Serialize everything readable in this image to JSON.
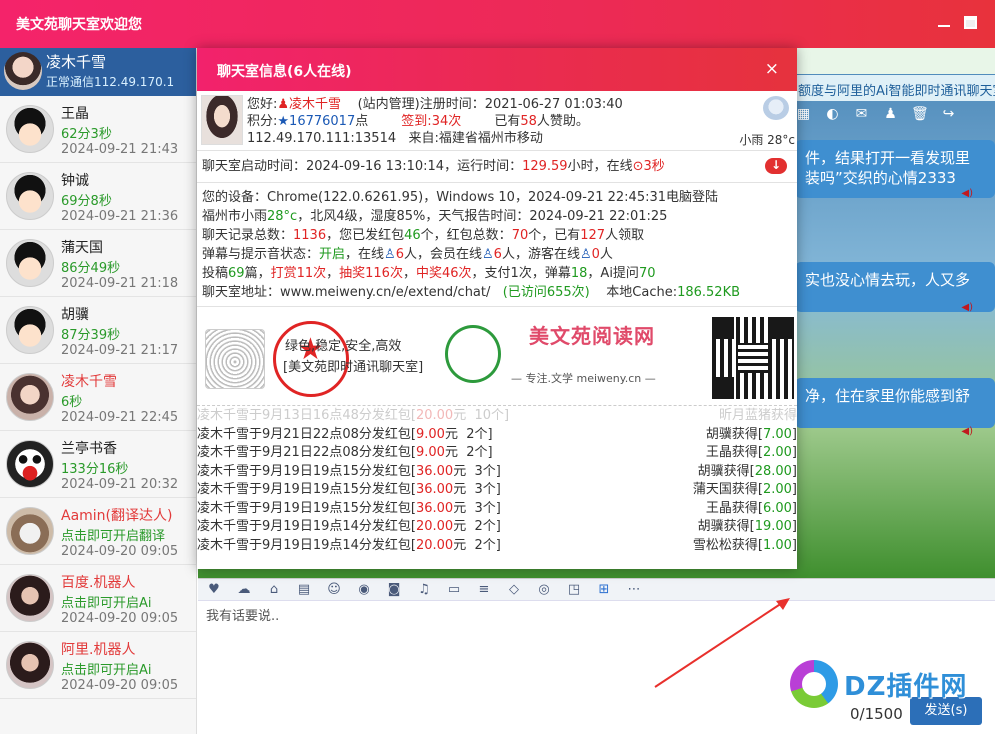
{
  "window": {
    "title": "美文苑聊天室欢迎您"
  },
  "me": {
    "name": "凌木千雪",
    "status": "正常通信112.49.170.1"
  },
  "users": [
    {
      "name": "王晶",
      "online": "62分3秒",
      "time": "2024-09-21 21:43",
      "name_color": "normal"
    },
    {
      "name": "钟诚",
      "online": "69分8秒",
      "time": "2024-09-21 21:36",
      "name_color": "normal"
    },
    {
      "name": "蒲天国",
      "online": "86分49秒",
      "time": "2024-09-21 21:18",
      "name_color": "normal"
    },
    {
      "name": "胡骥",
      "online": "87分39秒",
      "time": "2024-09-21 21:17",
      "name_color": "normal"
    },
    {
      "name": "凌木千雪",
      "online": "6秒",
      "time": "2024-09-21 22:45",
      "name_color": "red"
    },
    {
      "name": "兰亭书香",
      "online": "133分16秒",
      "time": "2024-09-21 20:32",
      "name_color": "normal"
    },
    {
      "name": "Aamin(翻译达人)",
      "online": "点击即可开启翻译",
      "time": "2024-09-20 09:05",
      "name_color": "red"
    },
    {
      "name": "百度.机器人",
      "online": "点击即可开启Ai",
      "time": "2024-09-20 09:05",
      "name_color": "red"
    },
    {
      "name": "阿里.机器人",
      "online": "点击即可开启Ai",
      "time": "2024-09-20 09:05",
      "name_color": "red"
    }
  ],
  "chat": {
    "ticker_top": "额度与阿里的Ai智能即时通讯聊天室",
    "bubbles": [
      "件，结果打开一看发现里 装吗”交织的心情2333",
      "实也没心情去玩，人又多",
      "净，住在家里你能感到舒"
    ]
  },
  "modal": {
    "title": "聊天室信息(6人在线)",
    "close": "×",
    "profile": {
      "greeting": "您好:",
      "name": "凌木千雪",
      "role_reg": "(站内管理)注册时间：2021-06-27 01:03:40",
      "points_label": "积分:",
      "points": "16776017",
      "points_unit": "点",
      "signin_label": "签到:",
      "signin": "34",
      "signin_unit": "次",
      "donate_pre": "已有",
      "donate_count": "58",
      "donate_post": "人赞助。",
      "ip": "112.49.170.111:13514",
      "from": "来自:福建省福州市移动",
      "weather": "小雨  28°c"
    },
    "run": {
      "start": "聊天室启动时间：2024-09-16 13:10:14，运行时间：",
      "hours": "129.59",
      "hours_unit": "小时，在线",
      "online": "3秒"
    },
    "info": {
      "device": "您的设备：Chrome(122.0.6261.95)，Windows 10，2024-09-21 22:45:31电脑登陆",
      "weather_pre": "福州市小雨",
      "temp": "28°c",
      "weather_post": "，北风4级，湿度85%，天气报告时间：2024-09-21 22:01:25",
      "chat_total_pre": "聊天记录总数：",
      "chat_total": "1136",
      "sent_pre": "，您已发红包",
      "sent": "46",
      "packet_total_pre": "个，红包总数：",
      "packet_total": "70",
      "claimed_pre": "个，已有",
      "claimed": "127",
      "claimed_post": "人领取",
      "danmaku_pre": "弹幕与提示音状态：",
      "danmaku": "开启",
      "online_pre": "，在线",
      "online": "6",
      "member_pre": "人，会员在线",
      "member": "6",
      "guest_pre": "人，游客在线",
      "guest": "0",
      "guest_post": "人",
      "posts_pre": "投稿",
      "posts": "69",
      "tip": "打赏11次",
      "lottery": "抽奖116次",
      "win": "中奖46次",
      "pay": "支付1次",
      "barrage_pre": "弹幕",
      "barrage": "18",
      "ai_pre": "Ai提问",
      "ai": "70",
      "addr_label": "聊天室地址：",
      "addr": "www.meiweny.cn/e/extend/chat/",
      "visits": "(已访问655次)",
      "cache_pre": "本地Cache:",
      "cache": "186.52KB"
    },
    "promo": {
      "slogan1": "绿色,稳定,安全,高效",
      "slogan2": "[美文苑即时通讯聊天室]",
      "brand": "美文苑阅读网",
      "brand_sub": "— 专注.文学 meiweny.cn —"
    },
    "packets": [
      {
        "who": "凌木千雪于9月13日16点48分发红包",
        "amount": "20.00",
        "unit": "元",
        "count": "10个",
        "taker": "昕月蓝猪获得",
        "take": "",
        "faded": true
      },
      {
        "who": "凌木千雪于9月21日22点08分发红包",
        "amount": "9.00",
        "unit": "元",
        "count": "2个",
        "taker": "胡骥获得",
        "take": "7.00",
        "faded": false
      },
      {
        "who": "凌木千雪于9月21日22点08分发红包",
        "amount": "9.00",
        "unit": "元",
        "count": "2个",
        "taker": "王晶获得",
        "take": "2.00",
        "faded": false
      },
      {
        "who": "凌木千雪于9月19日19点15分发红包",
        "amount": "36.00",
        "unit": "元",
        "count": "3个",
        "taker": "胡骥获得",
        "take": "28.00",
        "faded": false
      },
      {
        "who": "凌木千雪于9月19日19点15分发红包",
        "amount": "36.00",
        "unit": "元",
        "count": "3个",
        "taker": "蒲天国获得",
        "take": "2.00",
        "faded": false
      },
      {
        "who": "凌木千雪于9月19日19点15分发红包",
        "amount": "36.00",
        "unit": "元",
        "count": "3个",
        "taker": "王晶获得",
        "take": "6.00",
        "faded": false
      },
      {
        "who": "凌木千雪于9月19日19点14分发红包",
        "amount": "20.00",
        "unit": "元",
        "count": "2个",
        "taker": "胡骥获得",
        "take": "19.00",
        "faded": false
      },
      {
        "who": "凌木千雪于9月19日19点14分发红包",
        "amount": "20.00",
        "unit": "元",
        "count": "2个",
        "taker": "雪松松获得",
        "take": "1.00",
        "faded": false
      }
    ]
  },
  "composer": {
    "placeholder": "我有话要说..",
    "counter": "0/1500",
    "send": "发送(s)"
  },
  "watermark": {
    "text": "DZ插件网"
  }
}
